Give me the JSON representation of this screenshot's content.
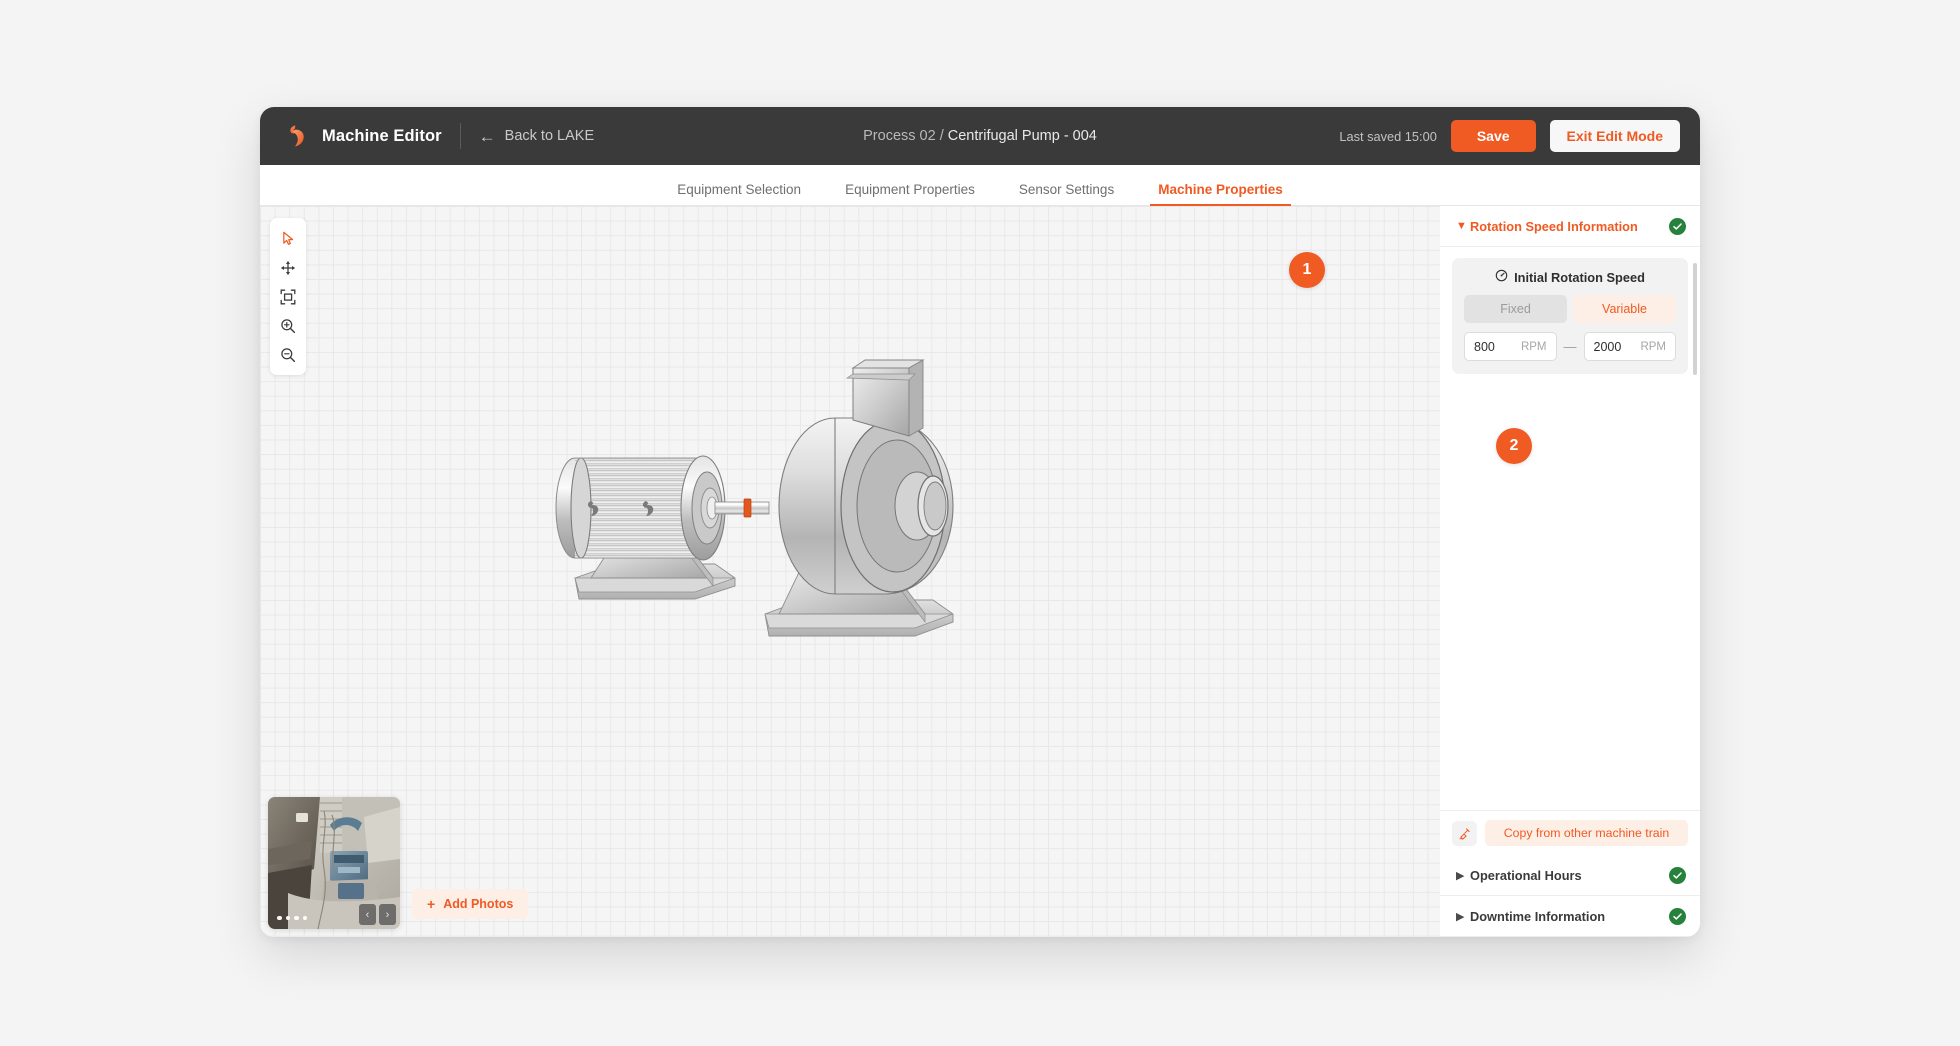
{
  "header": {
    "app_title": "Machine Editor",
    "logo_icon": "lake-logo-icon",
    "back_label": "Back to LAKE",
    "back_icon": "arrow-left-icon",
    "breadcrumb_parent": "Process 02 ",
    "breadcrumb_sep": "/ ",
    "breadcrumb_current": "Centrifugal Pump - 004",
    "last_saved": "Last saved 15:00",
    "save_label": "Save",
    "exit_label": "Exit Edit Mode"
  },
  "tabs": [
    {
      "label": "Equipment Selection",
      "active": false
    },
    {
      "label": "Equipment Properties",
      "active": false
    },
    {
      "label": "Sensor Settings",
      "active": false
    },
    {
      "label": "Machine Properties",
      "active": true
    }
  ],
  "canvas": {
    "tools": [
      {
        "name": "select-cursor-icon",
        "label": "Select",
        "active": true
      },
      {
        "name": "move-icon",
        "label": "Pan",
        "active": false
      },
      {
        "name": "fit-to-frame-icon",
        "label": "Fit to frame",
        "active": false
      },
      {
        "name": "zoom-in-icon",
        "label": "Zoom in",
        "active": false
      },
      {
        "name": "zoom-out-icon",
        "label": "Zoom out",
        "active": false
      }
    ],
    "machine_illustration": "centrifugal-pump-with-motor",
    "photos": {
      "dot_count": 4,
      "active_dot": 0,
      "prev_label": "‹",
      "next_label": "›",
      "add_photos_label": "Add Photos",
      "add_photos_icon": "plus-icon"
    }
  },
  "panel": {
    "sections": [
      {
        "title": "Rotation Speed Information",
        "expanded": true,
        "status_icon": "check-circle-icon"
      },
      {
        "title": "Operational Hours",
        "expanded": false,
        "status_icon": "check-circle-icon"
      },
      {
        "title": "Downtime Information",
        "expanded": false,
        "status_icon": "check-circle-icon"
      }
    ],
    "rotation_speed": {
      "field_title": "Initial Rotation Speed",
      "field_icon": "gauge-icon",
      "mode_options": [
        "Fixed",
        "Variable"
      ],
      "mode_selected": "Variable",
      "min_value": "800",
      "min_unit": "RPM",
      "separator": "—",
      "max_value": "2000",
      "max_unit": "RPM"
    },
    "copy_row": {
      "icon": "copy-machine-train-icon",
      "label": "Copy from other machine train"
    }
  },
  "callouts": [
    {
      "number": "1"
    },
    {
      "number": "2"
    }
  ],
  "colors": {
    "accent": "#f05a23",
    "accent_soft": "#fdeee6",
    "header_bg": "#3a3a3a",
    "success": "#26813c",
    "canvas_bg": "#f5f5f5"
  }
}
